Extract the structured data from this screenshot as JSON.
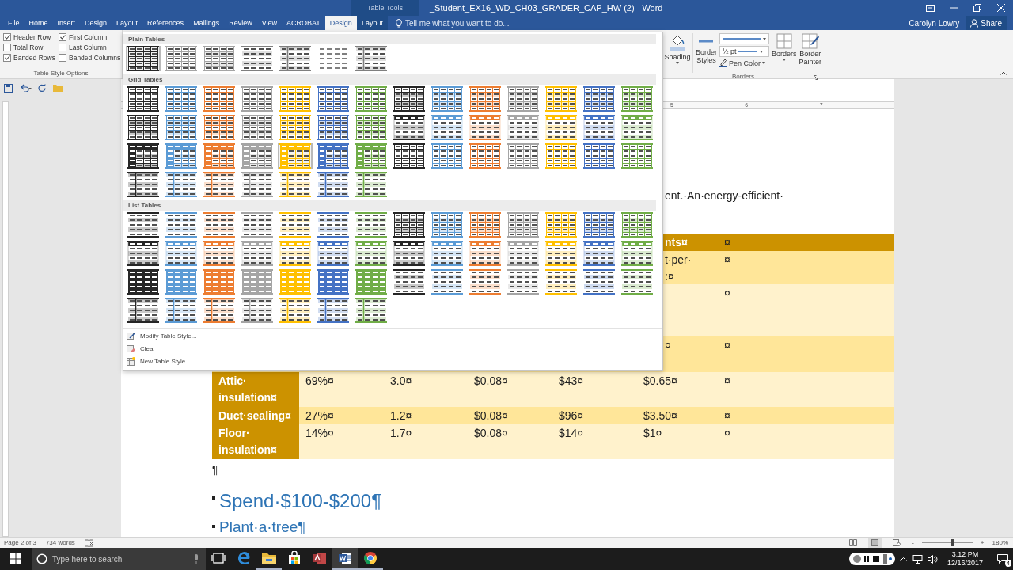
{
  "title_bar": {
    "context_label": "Table Tools",
    "title": "_Student_EX16_WD_CH03_GRADER_CAP_HW (2) - Word"
  },
  "tabs": [
    {
      "label": "File",
      "selected": false,
      "contextual": false
    },
    {
      "label": "Home",
      "selected": false,
      "contextual": false
    },
    {
      "label": "Insert",
      "selected": false,
      "contextual": false
    },
    {
      "label": "Design",
      "selected": false,
      "contextual": false
    },
    {
      "label": "Layout",
      "selected": false,
      "contextual": false
    },
    {
      "label": "References",
      "selected": false,
      "contextual": false
    },
    {
      "label": "Mailings",
      "selected": false,
      "contextual": false
    },
    {
      "label": "Review",
      "selected": false,
      "contextual": false
    },
    {
      "label": "View",
      "selected": false,
      "contextual": false
    },
    {
      "label": "ACROBAT",
      "selected": false,
      "contextual": false
    },
    {
      "label": "Design",
      "selected": true,
      "contextual": true
    },
    {
      "label": "Layout",
      "selected": false,
      "contextual": true
    }
  ],
  "tell_me": {
    "placeholder": "Tell me what you want to do..."
  },
  "user": "Carolyn Lowry",
  "share": "Share",
  "style_options": {
    "title": "Table Style Options",
    "checkboxes": [
      {
        "label": "Header Row",
        "checked": true
      },
      {
        "label": "First Column",
        "checked": true
      },
      {
        "label": "Total Row",
        "checked": false
      },
      {
        "label": "Last Column",
        "checked": false
      },
      {
        "label": "Banded Rows",
        "checked": true
      },
      {
        "label": "Banded Columns",
        "checked": false
      }
    ]
  },
  "borders_group": {
    "title": "Borders",
    "shading": "Shading",
    "border_styles": "Border Styles",
    "pen_weight": "½ pt",
    "pen_color": "Pen Color",
    "borders": "Borders",
    "border_painter": "Border Painter"
  },
  "gallery": {
    "sections": [
      {
        "title": "Plain Tables",
        "rows": [
          {
            "items": [
              {
                "kind": "bold-grid",
                "color": "#262626",
                "selected": true
              },
              {
                "kind": "outline",
                "color": "#a5a5a5",
                "selected": false
              },
              {
                "kind": "banded",
                "color": "#a5a5a5",
                "selected": false
              },
              {
                "kind": "rules",
                "color": "#7f7f7f",
                "selected": false
              },
              {
                "kind": "firstcol",
                "color": "#7f7f7f",
                "selected": false
              },
              {
                "kind": "plain",
                "color": "#7f7f7f",
                "selected": false
              },
              {
                "kind": "firstcol",
                "color": "#7f7f7f",
                "selected": false
              }
            ]
          }
        ]
      },
      {
        "title": "Grid Tables",
        "rows": [
          {
            "items": [
              {
                "kind": "outline",
                "color": "#262626",
                "selected": false
              },
              {
                "kind": "outline",
                "color": "#5b9bd5",
                "selected": false
              },
              {
                "kind": "outline",
                "color": "#ed7d31",
                "selected": false
              },
              {
                "kind": "outline",
                "color": "#a5a5a5",
                "selected": false
              },
              {
                "kind": "outline",
                "color": "#ffc000",
                "selected": false
              },
              {
                "kind": "outline",
                "color": "#4472c4",
                "selected": false
              },
              {
                "kind": "outline",
                "color": "#70ad47",
                "selected": false
              },
              {
                "kind": "banded",
                "color": "#262626",
                "selected": false
              },
              {
                "kind": "banded",
                "color": "#5b9bd5",
                "selected": false
              },
              {
                "kind": "banded",
                "color": "#ed7d31",
                "selected": false
              },
              {
                "kind": "banded",
                "color": "#a5a5a5",
                "selected": false
              },
              {
                "kind": "banded",
                "color": "#ffc000",
                "selected": false
              },
              {
                "kind": "banded",
                "color": "#4472c4",
                "selected": false
              },
              {
                "kind": "banded",
                "color": "#70ad47",
                "selected": false
              }
            ]
          },
          {
            "items": [
              {
                "kind": "banded",
                "color": "#262626",
                "selected": false
              },
              {
                "kind": "banded",
                "color": "#5b9bd5",
                "selected": false
              },
              {
                "kind": "banded",
                "color": "#ed7d31",
                "selected": false
              },
              {
                "kind": "banded",
                "color": "#a5a5a5",
                "selected": false
              },
              {
                "kind": "banded",
                "color": "#ffc000",
                "selected": false
              },
              {
                "kind": "banded",
                "color": "#4472c4",
                "selected": false
              },
              {
                "kind": "banded",
                "color": "#70ad47",
                "selected": false
              },
              {
                "kind": "header",
                "color": "#262626",
                "selected": false
              },
              {
                "kind": "header",
                "color": "#5b9bd5",
                "selected": false
              },
              {
                "kind": "header",
                "color": "#ed7d31",
                "selected": false
              },
              {
                "kind": "header",
                "color": "#a5a5a5",
                "selected": false
              },
              {
                "kind": "header",
                "color": "#ffc000",
                "selected": false
              },
              {
                "kind": "header",
                "color": "#4472c4",
                "selected": false
              },
              {
                "kind": "header",
                "color": "#70ad47",
                "selected": false
              }
            ]
          },
          {
            "items": [
              {
                "kind": "accent",
                "color": "#262626",
                "selected": false
              },
              {
                "kind": "accent",
                "color": "#5b9bd5",
                "selected": false
              },
              {
                "kind": "accent",
                "color": "#ed7d31",
                "selected": false
              },
              {
                "kind": "accent",
                "color": "#a5a5a5",
                "selected": false
              },
              {
                "kind": "accent",
                "color": "#ffc000",
                "selected": true
              },
              {
                "kind": "accent",
                "color": "#4472c4",
                "selected": false
              },
              {
                "kind": "accent",
                "color": "#70ad47",
                "selected": false
              },
              {
                "kind": "bold-grid",
                "color": "#262626",
                "selected": false
              },
              {
                "kind": "outline",
                "color": "#5b9bd5",
                "selected": false
              },
              {
                "kind": "outline",
                "color": "#ed7d31",
                "selected": false
              },
              {
                "kind": "outline",
                "color": "#a5a5a5",
                "selected": false
              },
              {
                "kind": "outline",
                "color": "#ffc000",
                "selected": false
              },
              {
                "kind": "outline",
                "color": "#4472c4",
                "selected": false
              },
              {
                "kind": "outline",
                "color": "#70ad47",
                "selected": false
              }
            ]
          },
          {
            "items": [
              {
                "kind": "firstcol",
                "color": "#262626",
                "selected": false
              },
              {
                "kind": "firstcol",
                "color": "#5b9bd5",
                "selected": false
              },
              {
                "kind": "firstcol",
                "color": "#ed7d31",
                "selected": false
              },
              {
                "kind": "firstcol",
                "color": "#a5a5a5",
                "selected": false
              },
              {
                "kind": "firstcol",
                "color": "#ffc000",
                "selected": false
              },
              {
                "kind": "firstcol",
                "color": "#4472c4",
                "selected": false
              },
              {
                "kind": "firstcol",
                "color": "#70ad47",
                "selected": false
              }
            ]
          }
        ]
      },
      {
        "title": "List Tables",
        "rows": [
          {
            "items": [
              {
                "kind": "rules",
                "color": "#262626",
                "selected": false
              },
              {
                "kind": "rules",
                "color": "#5b9bd5",
                "selected": false
              },
              {
                "kind": "rules",
                "color": "#ed7d31",
                "selected": false
              },
              {
                "kind": "rules",
                "color": "#a5a5a5",
                "selected": false
              },
              {
                "kind": "rules",
                "color": "#ffc000",
                "selected": false
              },
              {
                "kind": "rules",
                "color": "#4472c4",
                "selected": false
              },
              {
                "kind": "rules",
                "color": "#70ad47",
                "selected": false
              },
              {
                "kind": "banded",
                "color": "#262626",
                "selected": false
              },
              {
                "kind": "banded",
                "color": "#5b9bd5",
                "selected": false
              },
              {
                "kind": "banded",
                "color": "#ed7d31",
                "selected": false
              },
              {
                "kind": "banded",
                "color": "#a5a5a5",
                "selected": false
              },
              {
                "kind": "banded",
                "color": "#ffc000",
                "selected": false
              },
              {
                "kind": "banded",
                "color": "#4472c4",
                "selected": false
              },
              {
                "kind": "banded",
                "color": "#70ad47",
                "selected": false
              }
            ]
          },
          {
            "items": [
              {
                "kind": "header",
                "color": "#262626",
                "selected": false
              },
              {
                "kind": "header",
                "color": "#5b9bd5",
                "selected": false
              },
              {
                "kind": "header",
                "color": "#ed7d31",
                "selected": false
              },
              {
                "kind": "header",
                "color": "#a5a5a5",
                "selected": false
              },
              {
                "kind": "header",
                "color": "#ffc000",
                "selected": false
              },
              {
                "kind": "header",
                "color": "#4472c4",
                "selected": false
              },
              {
                "kind": "header",
                "color": "#70ad47",
                "selected": false
              },
              {
                "kind": "header",
                "color": "#262626",
                "selected": false
              },
              {
                "kind": "header",
                "color": "#5b9bd5",
                "selected": false
              },
              {
                "kind": "header",
                "color": "#ed7d31",
                "selected": false
              },
              {
                "kind": "header",
                "color": "#a5a5a5",
                "selected": false
              },
              {
                "kind": "header",
                "color": "#ffc000",
                "selected": false
              },
              {
                "kind": "header",
                "color": "#4472c4",
                "selected": false
              },
              {
                "kind": "header",
                "color": "#70ad47",
                "selected": false
              }
            ]
          },
          {
            "items": [
              {
                "kind": "solid",
                "color": "#262626",
                "selected": false
              },
              {
                "kind": "solid",
                "color": "#5b9bd5",
                "selected": false
              },
              {
                "kind": "solid",
                "color": "#ed7d31",
                "selected": false
              },
              {
                "kind": "solid",
                "color": "#a5a5a5",
                "selected": false
              },
              {
                "kind": "solid",
                "color": "#ffc000",
                "selected": false
              },
              {
                "kind": "solid",
                "color": "#4472c4",
                "selected": false
              },
              {
                "kind": "solid",
                "color": "#70ad47",
                "selected": false
              },
              {
                "kind": "rules",
                "color": "#262626",
                "selected": false
              },
              {
                "kind": "rules",
                "color": "#5b9bd5",
                "selected": false
              },
              {
                "kind": "rules",
                "color": "#ed7d31",
                "selected": false
              },
              {
                "kind": "rules",
                "color": "#a5a5a5",
                "selected": false
              },
              {
                "kind": "rules",
                "color": "#ffc000",
                "selected": false
              },
              {
                "kind": "rules",
                "color": "#4472c4",
                "selected": false
              },
              {
                "kind": "rules",
                "color": "#70ad47",
                "selected": false
              }
            ]
          },
          {
            "items": [
              {
                "kind": "firstcol",
                "color": "#262626",
                "selected": false
              },
              {
                "kind": "firstcol",
                "color": "#5b9bd5",
                "selected": false
              },
              {
                "kind": "firstcol",
                "color": "#ed7d31",
                "selected": false
              },
              {
                "kind": "firstcol",
                "color": "#a5a5a5",
                "selected": false
              },
              {
                "kind": "firstcol",
                "color": "#ffc000",
                "selected": false
              },
              {
                "kind": "firstcol",
                "color": "#4472c4",
                "selected": false
              },
              {
                "kind": "firstcol",
                "color": "#70ad47",
                "selected": false
              }
            ]
          }
        ]
      }
    ],
    "commands": [
      {
        "label": "Modify Table Style...",
        "kind": "modify"
      },
      {
        "label": "Clear",
        "kind": "clear"
      },
      {
        "label": "New Table Style...",
        "kind": "new"
      }
    ]
  },
  "ruler": {
    "numbers": [
      "5",
      "6",
      "7"
    ]
  },
  "document": {
    "intro_fragment": "ent.·An·energy-efficient·",
    "table": {
      "rows": [
        {
          "kind": "header",
          "tail": [
            "nts¤"
          ],
          "end": "¤"
        },
        {
          "kind": "dark",
          "tail": [
            "t·per·",
            ":¤"
          ],
          "end": "¤"
        },
        {
          "kind": "light",
          "end": "¤"
        },
        {
          "kind": "dark",
          "tail": [
            "¤"
          ],
          "end": "¤"
        },
        {
          "kind": "light",
          "label_lines": [
            "Attic·",
            "insulation¤"
          ],
          "values": [
            "69%¤",
            "3.0¤",
            "$0.08¤",
            "$43¤",
            "$0.65¤"
          ],
          "end": "¤"
        },
        {
          "kind": "dark",
          "label_lines": [
            "Duct·sealing¤"
          ],
          "values": [
            "27%¤",
            "1.2¤",
            "$0.08¤",
            "$96¤",
            "$3.50¤"
          ],
          "end": "¤"
        },
        {
          "kind": "light",
          "label_lines": [
            "Floor·",
            "insulation¤"
          ],
          "values": [
            "14%¤",
            "1.7¤",
            "$0.08¤",
            "$14¤",
            "$1¤"
          ],
          "end": "¤"
        }
      ]
    },
    "pilcrow": "¶",
    "bullets": [
      {
        "text": "Spend·$100-$200¶",
        "kind": "large"
      },
      {
        "text": "Plant·a·tree¶",
        "kind": "small"
      }
    ]
  },
  "status": {
    "page": "Page 2 of 3",
    "words": "734 words",
    "zoom_out": "-",
    "zoom_in": "+",
    "zoom": "180%",
    "zoom_slider": {
      "level": 0.58
    }
  },
  "taskbar": {
    "search": {
      "placeholder": "Type here to search"
    },
    "apps": [
      {
        "kind": "task-view",
        "selected": false,
        "running": false
      },
      {
        "kind": "edge",
        "selected": false,
        "running": false
      },
      {
        "kind": "explorer",
        "selected": false,
        "running": true
      },
      {
        "kind": "store",
        "selected": false,
        "running": false
      },
      {
        "kind": "access",
        "selected": false,
        "running": false
      },
      {
        "kind": "word",
        "selected": true,
        "running": true
      },
      {
        "kind": "chrome",
        "selected": false,
        "running": true
      }
    ],
    "time": "3:12 PM",
    "date": "12/16/2017",
    "notifications": "4"
  }
}
